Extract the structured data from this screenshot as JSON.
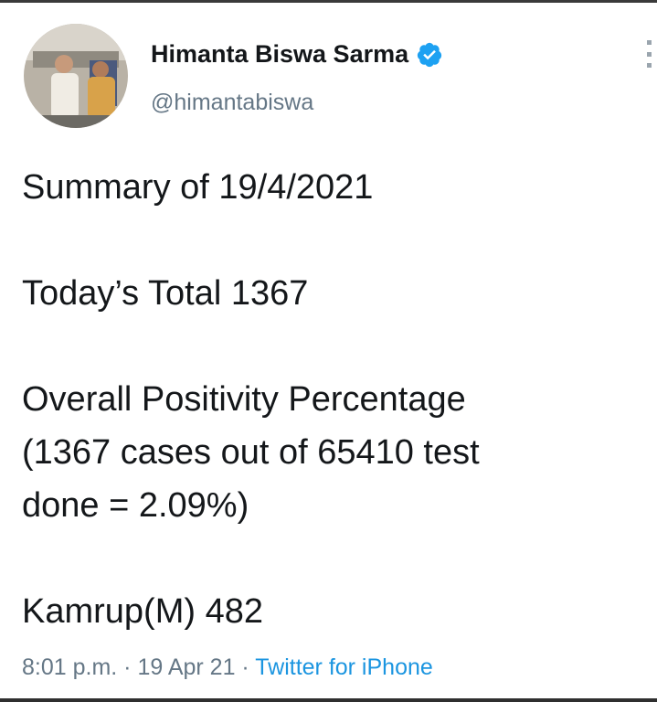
{
  "tweet": {
    "author": {
      "name": "Himanta Biswa Sarma",
      "handle": "@himantabiswa",
      "verified": true,
      "verified_color": "#1da1f2"
    },
    "lines": {
      "summary": "Summary of 19/4/2021",
      "total": "Today’s Total 1367",
      "positivity_1": "Overall Positivity Percentage",
      "positivity_2": "(1367 cases out of 65410 test",
      "positivity_3": "done = 2.09%)",
      "district": "Kamrup(M) 482"
    },
    "meta": {
      "time": "8:01 p.m.",
      "separator_1": " · ",
      "date": "19 Apr 21",
      "separator_2": " · ",
      "source": "Twitter for iPhone"
    }
  },
  "colors": {
    "text": "#14171a",
    "secondary": "#657786",
    "link": "#1b95e0"
  },
  "icons": [
    "verified-badge-icon",
    "more-options-icon"
  ]
}
